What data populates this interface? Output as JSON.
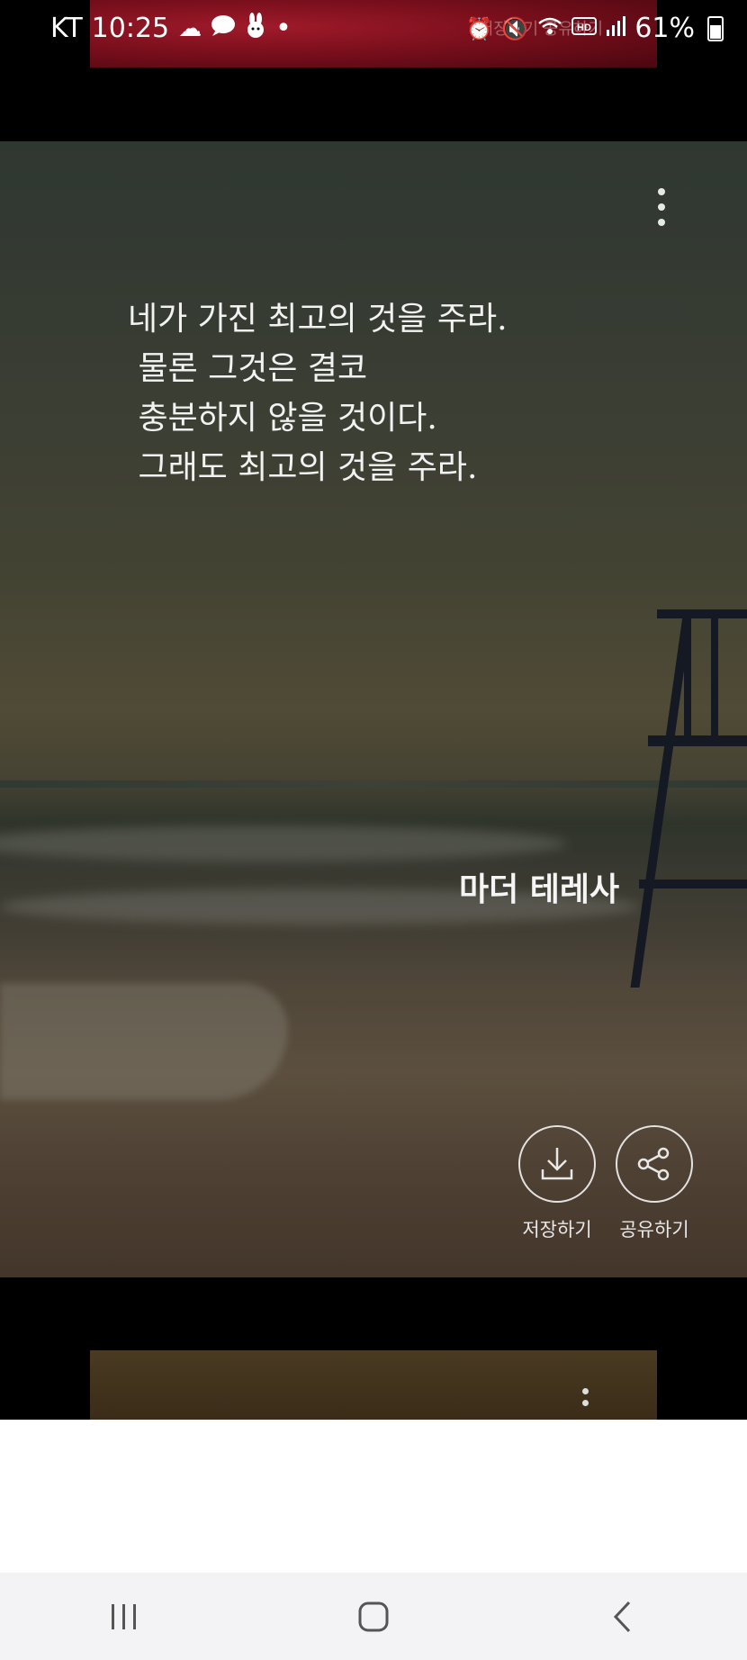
{
  "status_bar": {
    "carrier": "KT",
    "time": "10:25",
    "dot": "•",
    "battery": "61%",
    "icons_left": [
      "cloud-icon",
      "speech-bubble-icon",
      "rabbit-icon"
    ],
    "icons_right": [
      "alarm-icon",
      "mute-icon",
      "wifi-icon",
      "hd-icon",
      "signal-icon",
      "battery-icon"
    ]
  },
  "card": {
    "quote_lines": [
      "네가 가진 최고의 것을 주라.",
      " 물론 그것은 결코",
      " 충분하지 않을 것이다.",
      " 그래도 최고의 것을 주라."
    ],
    "author": "마더 테레사",
    "save_label": "저장하기",
    "share_label": "공유하기",
    "ghost_text": "저장하기 공유하기"
  },
  "colors": {
    "background": "#000000",
    "text": "#f2f2f2",
    "nav_bar": "#f3f3f5"
  }
}
